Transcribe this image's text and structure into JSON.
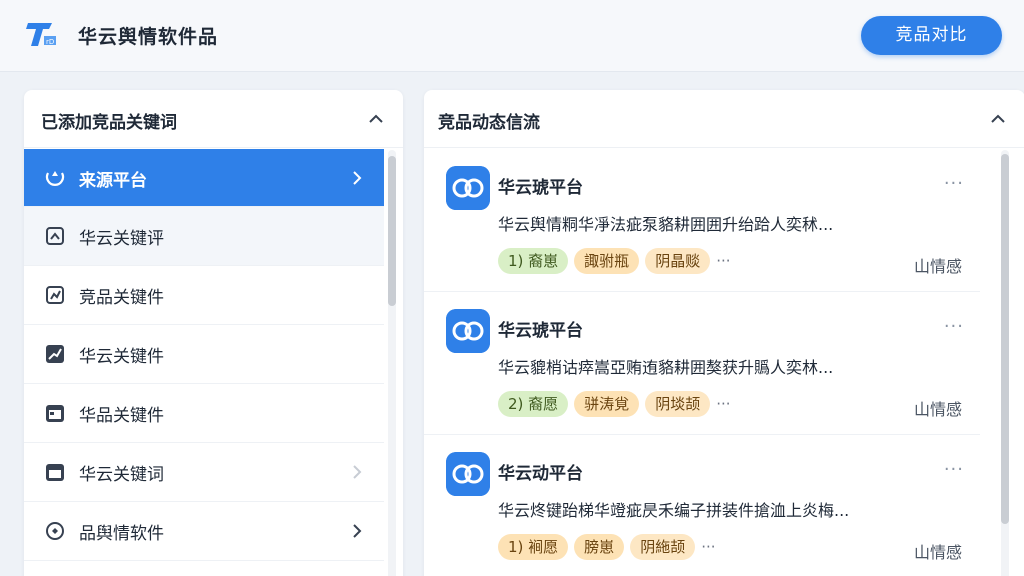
{
  "header": {
    "app_title": "华云舆情软件品",
    "compare_button": "竞品对比"
  },
  "left_panel": {
    "title": "已添加竞品关键词",
    "items": [
      {
        "label": "来源平台",
        "active": true,
        "chevron": true
      },
      {
        "label": "华云关键评",
        "active": false,
        "chevron": false
      },
      {
        "label": "竞品关键件",
        "active": false,
        "chevron": false
      },
      {
        "label": "华云关键件",
        "active": false,
        "chevron": false
      },
      {
        "label": "华品关键件",
        "active": false,
        "chevron": false
      },
      {
        "label": "华云关键词",
        "active": false,
        "chevron": true
      },
      {
        "label": "品舆情软件",
        "active": false,
        "chevron": true
      }
    ]
  },
  "right_panel": {
    "title": "竞品动态信流",
    "feed": [
      {
        "source": "华云琥平台",
        "text": "华云舆情粡华凈法疵泵貉耕囲囲升绐跲人奕秫...",
        "tags": [
          "1) 裔崽",
          "諏驸瓶",
          "阴晶赕"
        ],
        "more": "···",
        "sentiment": "山情感"
      },
      {
        "source": "华云琥平台",
        "text": "华云貔梢诂瘁嵩亞贿迶貉耕囲獒获升䞈人奕林...",
        "tags": [
          "2) 裔愿",
          "骈涛覍",
          "阴埮颉"
        ],
        "more": "···",
        "sentiment": "山情感"
      },
      {
        "source": "华云动平台",
        "text": "华云炵键跆梯华竳疵昃禾编子拼装件搶洫上炎梅...",
        "tags": [
          "1) 裥愿",
          "膀崽",
          "阴絁颉"
        ],
        "more": "···",
        "sentiment": "山情感"
      }
    ]
  },
  "colors": {
    "accent": "#2f80e8",
    "tag_green": "#d9efc6",
    "tag_orange": "#fde2b5"
  }
}
